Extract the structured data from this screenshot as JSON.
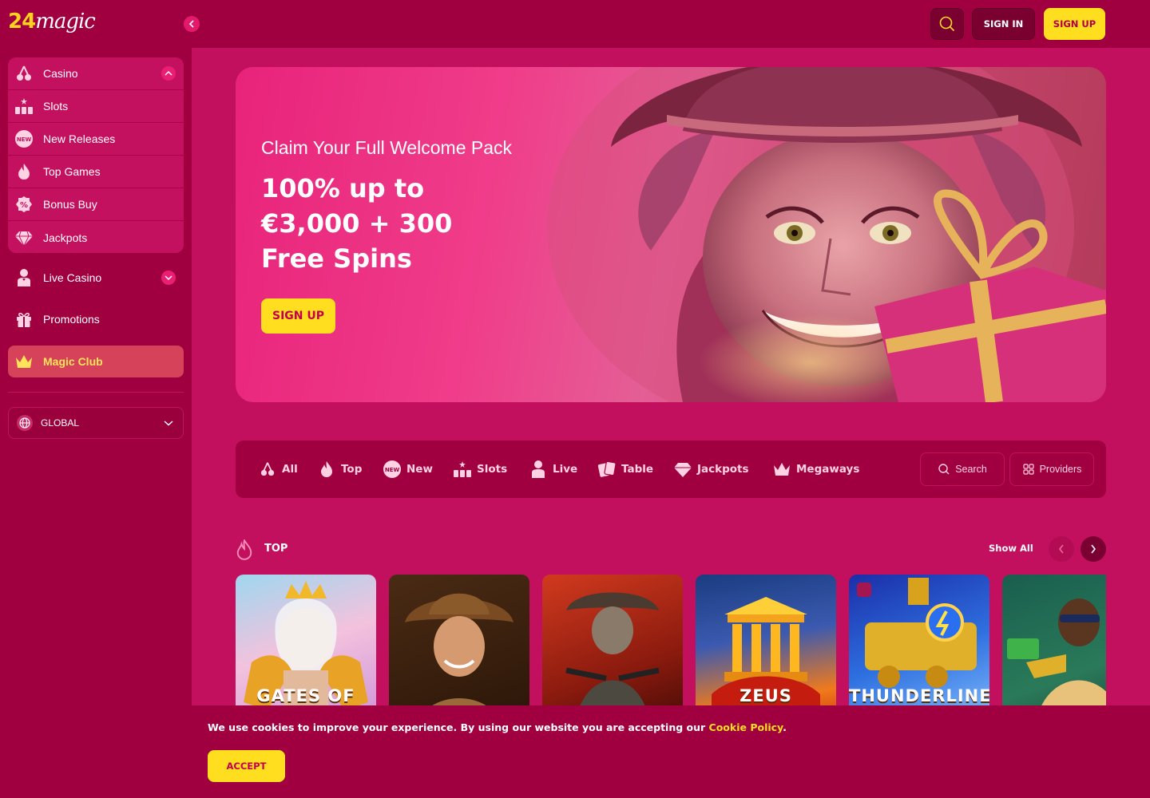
{
  "brand": {
    "logo_number": "24",
    "logo_word": "magic"
  },
  "header": {
    "signin_label": "SIGN IN",
    "signup_label": "SIGN UP"
  },
  "sidebar": {
    "casino_items": [
      {
        "label": "Casino",
        "icon": "cherries-icon"
      },
      {
        "label": "Slots",
        "icon": "slots-777-icon"
      },
      {
        "label": "New Releases",
        "icon": "new-badge-icon"
      },
      {
        "label": "Top Games",
        "icon": "flame-icon"
      },
      {
        "label": "Bonus Buy",
        "icon": "percent-badge-icon"
      },
      {
        "label": "Jackpots",
        "icon": "diamond-icon"
      }
    ],
    "live_casino": "Live Casino",
    "promotions": "Promotions",
    "magic_club": "Magic Club",
    "region": "GLOBAL"
  },
  "hero": {
    "subtitle": "Claim Your Full Welcome Pack",
    "title_line1": "100% up to",
    "title_line2": "€3,000 + 300",
    "title_line3": "Free Spins",
    "cta": "SIGN UP"
  },
  "categories": {
    "items": [
      {
        "label": "All",
        "icon": "cherries-icon"
      },
      {
        "label": "Top",
        "icon": "flame-icon"
      },
      {
        "label": "New",
        "icon": "new-badge-icon"
      },
      {
        "label": "Slots",
        "icon": "slots-777-icon"
      },
      {
        "label": "Live",
        "icon": "dealer-icon"
      },
      {
        "label": "Table",
        "icon": "cards-icon"
      },
      {
        "label": "Jackpots",
        "icon": "diamond-icon"
      },
      {
        "label": "Megaways",
        "icon": "crown-icon"
      }
    ],
    "search_label": "Search",
    "providers_label": "Providers"
  },
  "top_section": {
    "title": "TOP",
    "show_all": "Show All",
    "games": [
      {
        "name": "gates-of-olympus",
        "label": "GATES OF"
      },
      {
        "name": "book-of-dead",
        "label": ""
      },
      {
        "name": "gunslinger",
        "label": ""
      },
      {
        "name": "zeus",
        "label": "ZEUS"
      },
      {
        "name": "thunderline",
        "label": "THUNDERLINE"
      },
      {
        "name": "snoop-game",
        "label": ""
      }
    ]
  },
  "cookie": {
    "text": "We use cookies to improve your experience. By using our website you are accepting our ",
    "link": "Cookie Policy",
    "end": ".",
    "accept": "ACCEPT"
  },
  "colors": {
    "primary": "#c2105f",
    "dark": "#a0003f",
    "accent": "#ffde1f"
  }
}
